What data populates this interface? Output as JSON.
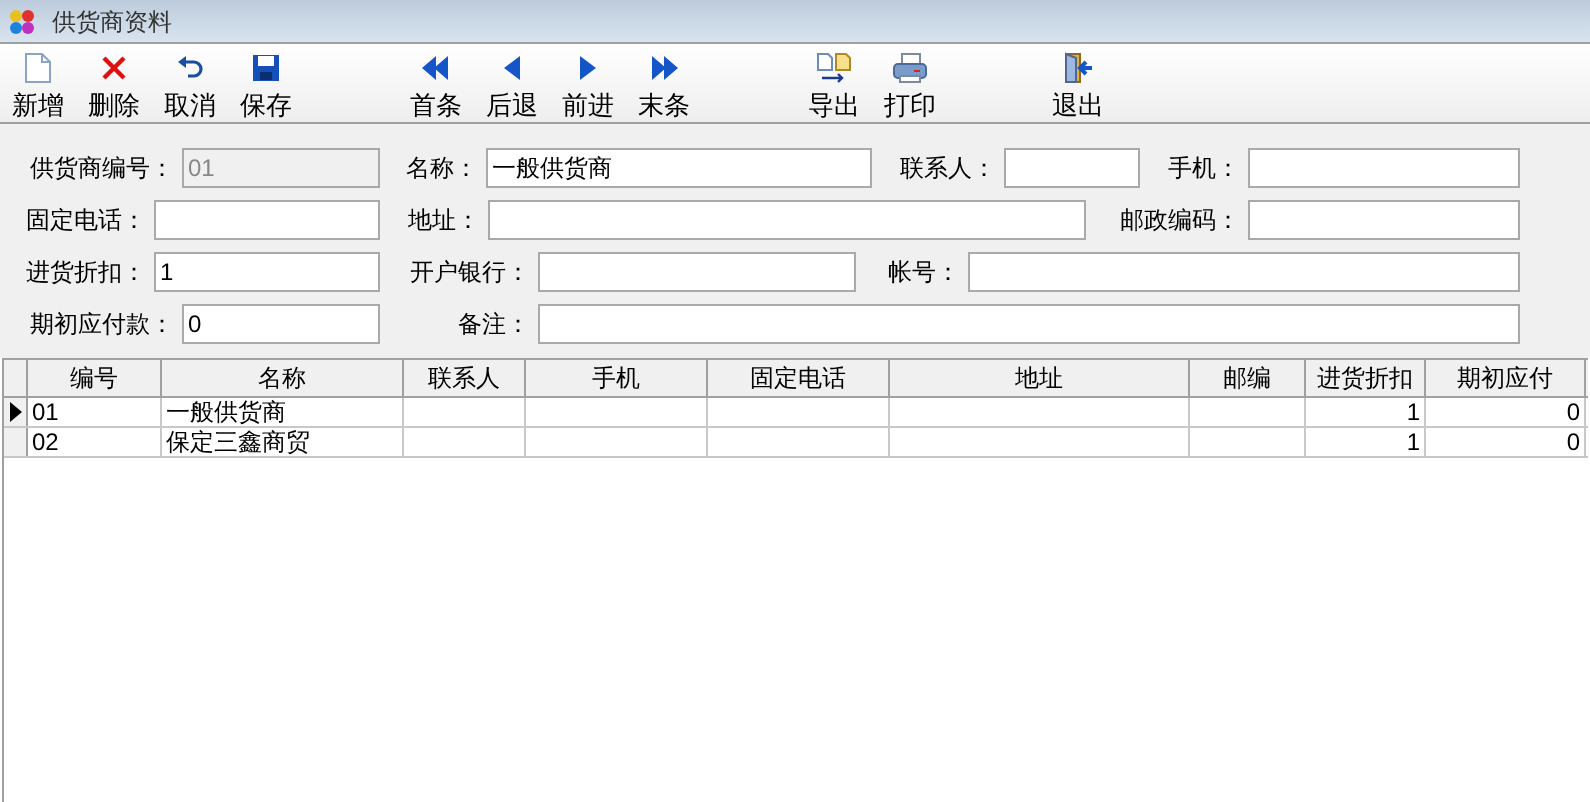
{
  "window": {
    "title": "供货商资料"
  },
  "toolbar": {
    "groups": [
      [
        "新增",
        "删除",
        "取消",
        "保存"
      ],
      [
        "首条",
        "后退",
        "前进",
        "末条"
      ],
      [
        "导出",
        "打印"
      ],
      [
        "退出"
      ]
    ]
  },
  "form": {
    "fields": [
      {
        "label": "供货商编号：",
        "value": "01",
        "disabled": true
      },
      {
        "label": "名称：",
        "value": "一般供货商",
        "disabled": false
      },
      {
        "label": "联系人：",
        "disabled": false
      },
      {
        "label": "手机：",
        "disabled": false
      },
      {
        "label": "固定电话：",
        "disabled": false
      },
      {
        "label": "地址：",
        "disabled": false
      },
      {
        "label": "邮政编码：",
        "disabled": false
      },
      {
        "label": "进货折扣：",
        "value": "1",
        "disabled": false
      },
      {
        "label": "开户银行：",
        "disabled": false
      },
      {
        "label": "帐号：",
        "disabled": false
      },
      {
        "label": "期初应付款：",
        "value": "0",
        "disabled": false
      },
      {
        "label": "备注：",
        "disabled": false
      }
    ]
  },
  "table": {
    "columns": [
      "编号",
      "名称",
      "联系人",
      "手机",
      "固定电话",
      "地址",
      "邮编",
      "进货折扣",
      "期初应付"
    ],
    "rows": [
      {
        "selected": true,
        "cells": [
          "01",
          "一般供货商",
          "",
          "",
          "",
          "",
          "",
          "1",
          "0"
        ]
      },
      {
        "selected": false,
        "cells": [
          "02",
          "保定三鑫商贸",
          "",
          "",
          "",
          "",
          "",
          "1",
          "0"
        ]
      }
    ]
  }
}
